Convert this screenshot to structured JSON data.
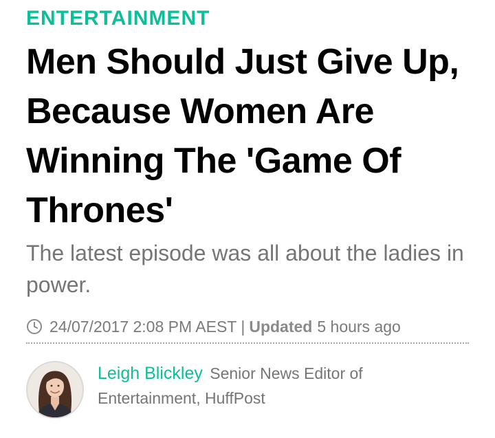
{
  "section": {
    "label": "ENTERTAINMENT"
  },
  "article": {
    "headline": "Men Should Just Give Up, Because Women Are Winning The 'Game Of Thrones'",
    "subheadline": "The latest episode was all about the ladies in power."
  },
  "timestamp": {
    "icon": "clock-icon",
    "published": "24/07/2017 2:08 PM AEST",
    "separator": "|",
    "updated_label": "Updated",
    "updated_value": "5 hours ago"
  },
  "byline": {
    "author_name": "Leigh Blickley",
    "author_title": "Senior News Editor of Entertainment, HuffPost",
    "avatar": "author-avatar"
  },
  "colors": {
    "accent": "#0dbe98",
    "headline": "#000000",
    "muted_text": "#757575"
  }
}
